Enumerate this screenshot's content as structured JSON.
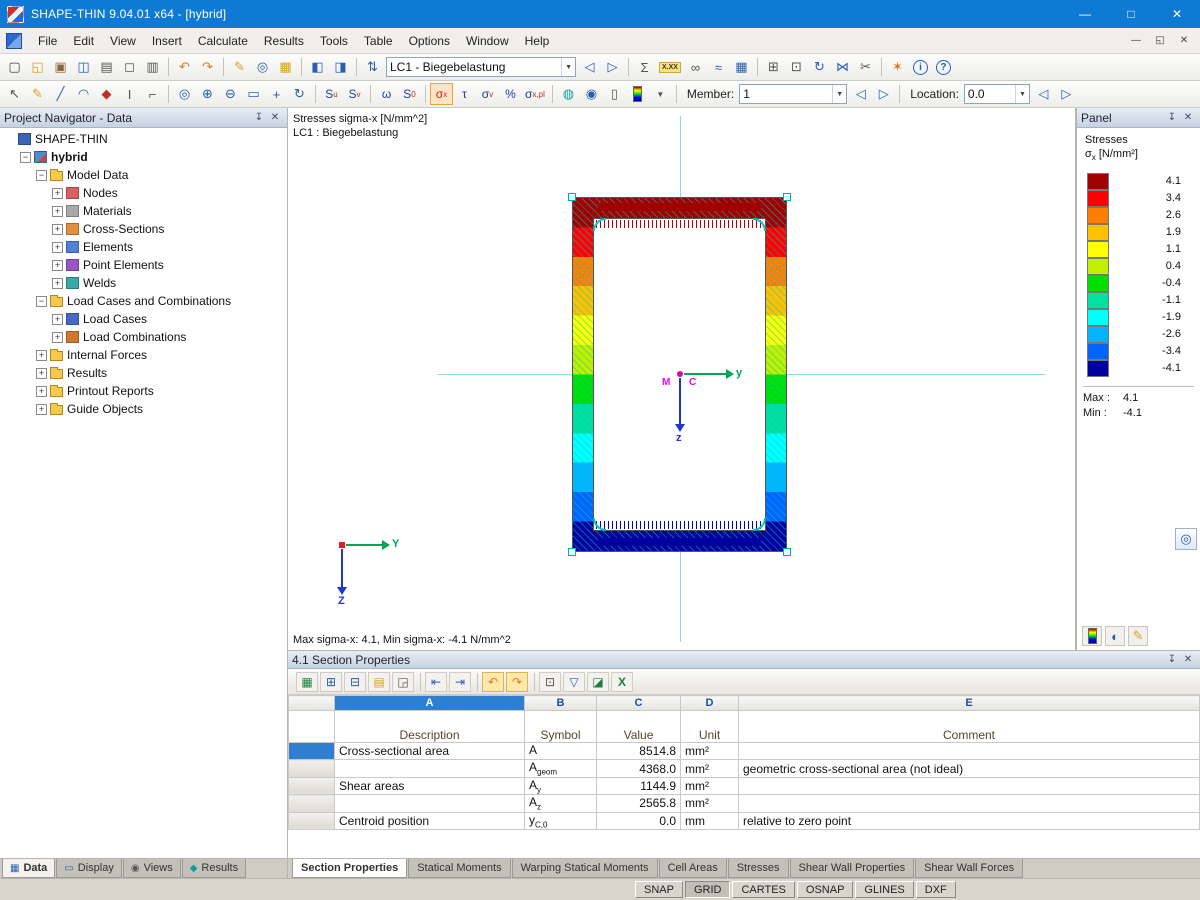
{
  "titlebar": {
    "title": "SHAPE-THIN 9.04.01 x64 - [hybrid]"
  },
  "menubar": {
    "items": [
      "File",
      "Edit",
      "View",
      "Insert",
      "Calculate",
      "Results",
      "Tools",
      "Table",
      "Options",
      "Window",
      "Help"
    ]
  },
  "icons": {
    "minimize": "—",
    "maximize": "□",
    "close": "✕",
    "restore": "◱",
    "pin": "↧",
    "plus": "+",
    "minus": "−",
    "dropdown": "▼",
    "prev": "◁",
    "next": "▷",
    "new": "▢",
    "open": "◱",
    "save_all": "▣",
    "save": "◫",
    "print": "▤",
    "preview": "◻",
    "copy": "▥",
    "undo": "↶",
    "redo": "↷",
    "edit": "✎",
    "zoom_region": "◎",
    "table": "▦",
    "split_view": "◧",
    "table_view": "◨",
    "loadcase": "⇅",
    "calculate": "Σ",
    "format": "X.XX",
    "check_results": "∞",
    "diagram": "≈",
    "result_table": "▦",
    "grid": "⊞",
    "snap": "⊡",
    "rotate": "↻",
    "mirror": "⋈",
    "cut": "✂",
    "settings": "✶",
    "info": "i",
    "help": "?",
    "select": "↖",
    "draw": "✎",
    "line": "╱",
    "arc": "◠",
    "node": "◆",
    "beam": "Ι",
    "measure": "⌐",
    "zoom_window": "◎",
    "zoom_in": "⊕",
    "zoom_out": "⊖",
    "zoom_all": "▭",
    "pan": "+",
    "rotate_view": "↻",
    "visibility": "◉",
    "rendering": "◍",
    "sheet": "▯",
    "goto": "▦",
    "row_insert": "⊞",
    "row_delete": "⊟",
    "fill": "▤",
    "corner": "◲",
    "arrow_in": "⇤",
    "arrow_out": "⇥",
    "calculator": "⊡",
    "filter": "▽",
    "chart": "◪",
    "excel": "X",
    "magnifier": "◎",
    "globe": "◐",
    "pen": "✎"
  },
  "toolbar_main": {
    "lc_combo": "LC1 - Biegebelastung"
  },
  "toolbar_results": {
    "buttons": [
      {
        "main": "S",
        "sub": "u"
      },
      {
        "main": "S",
        "sub": "v"
      },
      {
        "main": "ω",
        "sub": ""
      },
      {
        "main": "S",
        "sub": "0"
      },
      {
        "main": "σ",
        "sub": "x"
      },
      {
        "main": "τ",
        "sub": ""
      },
      {
        "main": "σ",
        "sub": "v"
      },
      {
        "main": "%",
        "sub": ""
      },
      {
        "main": "σ",
        "sub": "x,pl"
      }
    ],
    "member_label": "Member:",
    "member_value": "1",
    "location_label": "Location:",
    "location_value": "0.0"
  },
  "navigator": {
    "title": "Project Navigator - Data",
    "items": [
      {
        "label": "SHAPE-THIN"
      },
      {
        "label": "hybrid"
      },
      {
        "label": "Model Data"
      },
      {
        "label": "Nodes"
      },
      {
        "label": "Materials"
      },
      {
        "label": "Cross-Sections"
      },
      {
        "label": "Elements"
      },
      {
        "label": "Point Elements"
      },
      {
        "label": "Welds"
      },
      {
        "label": "Load Cases and Combinations"
      },
      {
        "label": "Load Cases"
      },
      {
        "label": "Load Combinations"
      },
      {
        "label": "Internal Forces"
      },
      {
        "label": "Results"
      },
      {
        "label": "Printout Reports"
      },
      {
        "label": "Guide Objects"
      }
    ]
  },
  "dock_tabs": [
    {
      "label": "Data"
    },
    {
      "label": "Display"
    },
    {
      "label": "Views"
    },
    {
      "label": "Results"
    }
  ],
  "canvas": {
    "header_line1": "Stresses sigma-x [N/mm^2]",
    "header_line2": "LC1 : Biegebelastung",
    "footer": "Max sigma-x: 4.1, Min sigma-x: -4.1 N/mm^2",
    "axis_center": {
      "y_label": "y",
      "z_label": "z",
      "m_label": "M",
      "c_label": "C"
    },
    "axis_origin": {
      "y_label": "Y",
      "z_label": "Z"
    }
  },
  "panel": {
    "title": "Panel",
    "section_label": "Stresses",
    "unit_sigma": "σ",
    "unit_sub": "x",
    "unit_rest": "[N/mm²]",
    "legend": [
      {
        "value": "4.1",
        "color": "#A00000"
      },
      {
        "value": "3.4",
        "color": "#FF0000"
      },
      {
        "value": "2.6",
        "color": "#FF8000"
      },
      {
        "value": "1.9",
        "color": "#FFC000"
      },
      {
        "value": "1.1",
        "color": "#FFFF00"
      },
      {
        "value": "0.4",
        "color": "#C0F000"
      },
      {
        "value": "-0.4",
        "color": "#00E000"
      },
      {
        "value": "-1.1",
        "color": "#00E0A0"
      },
      {
        "value": "-1.9",
        "color": "#00FFFF"
      },
      {
        "value": "-2.6",
        "color": "#00B4FF"
      },
      {
        "value": "-3.4",
        "color": "#0064FF"
      },
      {
        "value": "-4.1",
        "color": "#0000A0"
      }
    ],
    "max_label": "Max :",
    "max_value": "4.1",
    "min_label": "Min :",
    "min_value": "-4.1"
  },
  "properties": {
    "title": "4.1 Section Properties",
    "letters": {
      "a": "A",
      "b": "B",
      "c": "C",
      "d": "D",
      "e": "E"
    },
    "headers": {
      "description": "Description",
      "symbol": "Symbol",
      "value": "Value",
      "unit": "Unit",
      "comment": "Comment"
    },
    "rows": [
      {
        "desc": "Cross-sectional area",
        "sym": "A",
        "sub": "",
        "value": "8514.8",
        "unit": "mm²",
        "comment": ""
      },
      {
        "desc": "",
        "sym": "A",
        "sub": "geom",
        "value": "4368.0",
        "unit": "mm²",
        "comment": "geometric cross-sectional area (not ideal)"
      },
      {
        "desc": "Shear areas",
        "sym": "A",
        "sub": "y",
        "value": "1144.9",
        "unit": "mm²",
        "comment": ""
      },
      {
        "desc": "",
        "sym": "A",
        "sub": "z",
        "value": "2565.8",
        "unit": "mm²",
        "comment": ""
      },
      {
        "desc": "Centroid position",
        "sym": "y",
        "sub": "C,0",
        "value": "0.0",
        "unit": "mm",
        "comment": "relative to zero point"
      }
    ],
    "tabs": [
      "Section Properties",
      "Statical Moments",
      "Warping Statical Moments",
      "Cell Areas",
      "Stresses",
      "Shear Wall Properties",
      "Shear Wall Forces"
    ]
  },
  "statusbar": {
    "buttons": [
      "SNAP",
      "GRID",
      "CARTES",
      "OSNAP",
      "GLINES",
      "DXF"
    ]
  }
}
